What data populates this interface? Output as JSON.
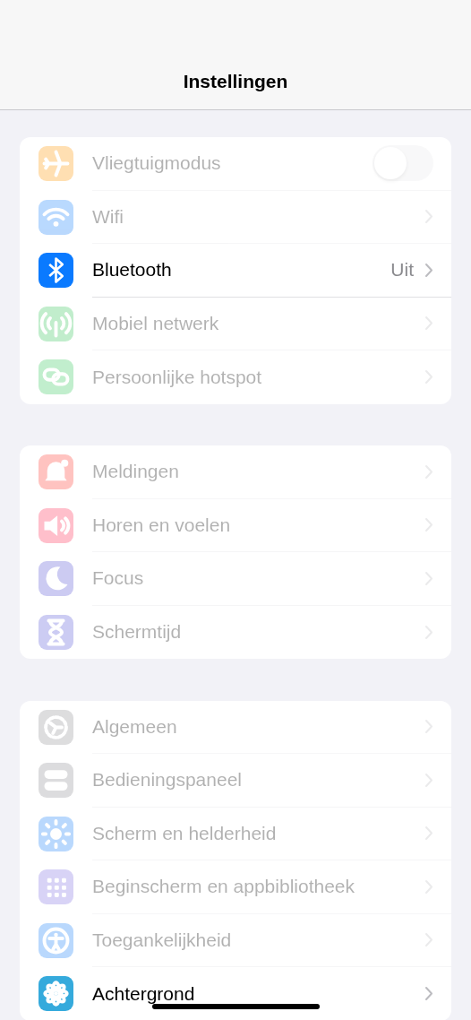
{
  "navigation_bar": {
    "title": "Instellingen"
  },
  "groups": [
    {
      "rows": [
        {
          "kind": "toggle",
          "label": "Vliegtuigmodus",
          "on": false,
          "dimmed": true
        },
        {
          "kind": "link",
          "label": "Wifi",
          "dimmed": true
        },
        {
          "kind": "link",
          "label": "Bluetooth",
          "value": "Uit",
          "dimmed": false
        },
        {
          "kind": "link",
          "label": "Mobiel netwerk",
          "dimmed": true
        },
        {
          "kind": "link",
          "label": "Persoonlijke hotspot",
          "dimmed": true
        }
      ]
    },
    {
      "rows": [
        {
          "kind": "link",
          "label": "Meldingen",
          "dimmed": true
        },
        {
          "kind": "link",
          "label": "Horen en voelen",
          "dimmed": true
        },
        {
          "kind": "link",
          "label": "Focus",
          "dimmed": true
        },
        {
          "kind": "link",
          "label": "Schermtijd",
          "dimmed": true
        }
      ]
    },
    {
      "rows": [
        {
          "kind": "link",
          "label": "Algemeen",
          "dimmed": true
        },
        {
          "kind": "link",
          "label": "Bedieningspaneel",
          "dimmed": true
        },
        {
          "kind": "link",
          "label": "Scherm en helderheid",
          "dimmed": true
        },
        {
          "kind": "link",
          "label": "Beginscherm en appbibliotheek",
          "dimmed": true
        },
        {
          "kind": "link",
          "label": "Toegankelijkheid",
          "dimmed": true
        },
        {
          "kind": "link",
          "label": "Achtergrond",
          "dimmed": false
        }
      ]
    }
  ]
}
